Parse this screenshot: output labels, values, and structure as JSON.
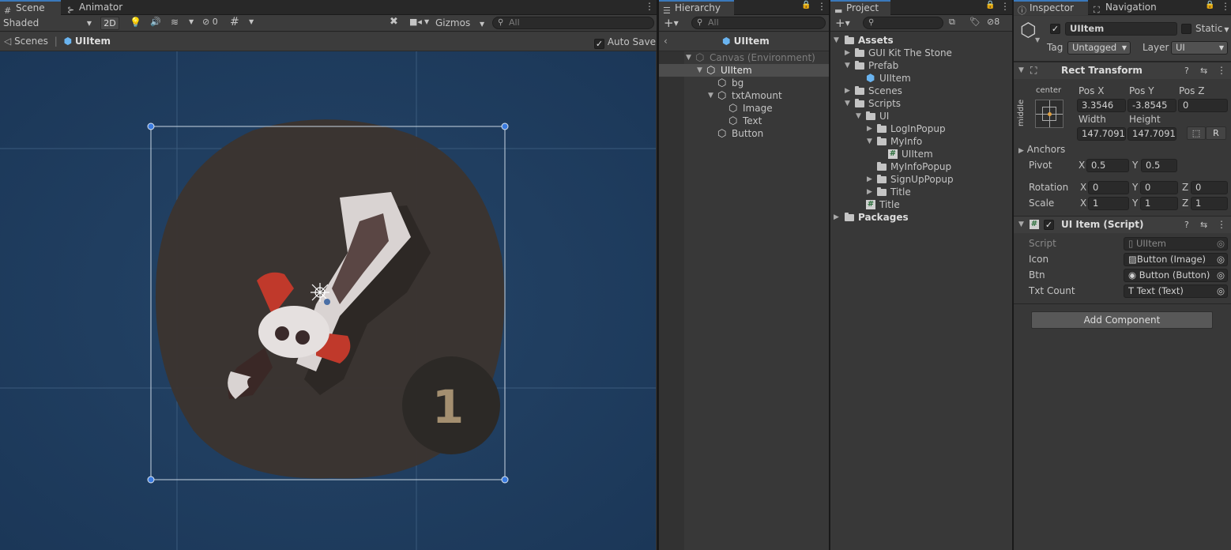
{
  "scene": {
    "tabs": [
      "Scene",
      "Animator"
    ],
    "shading_mode": "Shaded",
    "toggle_2d": "2D",
    "hidden_count": "0",
    "gizmos_label": "Gizmos",
    "search_placeholder": "All",
    "breadcrumb_root": "Scenes",
    "breadcrumb_item": "UIItem",
    "auto_save_label": "Auto Save",
    "item_count": "1"
  },
  "hierarchy": {
    "tab": "Hierarchy",
    "search_placeholder": "All",
    "prefab_title": "UIItem",
    "items": [
      {
        "label": "Canvas (Environment)",
        "indent": 0,
        "expanded": true,
        "dim": true
      },
      {
        "label": "UIItem",
        "indent": 1,
        "expanded": true,
        "selected": true
      },
      {
        "label": "bg",
        "indent": 2
      },
      {
        "label": "txtAmount",
        "indent": 2,
        "expanded": true
      },
      {
        "label": "Image",
        "indent": 3
      },
      {
        "label": "Text",
        "indent": 3
      },
      {
        "label": "Button",
        "indent": 2
      }
    ]
  },
  "project": {
    "tab": "Project",
    "hidden_count": "8",
    "items": [
      {
        "label": "Assets",
        "indent": 0,
        "type": "folder",
        "arrow": "down",
        "bold": true
      },
      {
        "label": "GUI Kit The Stone",
        "indent": 1,
        "type": "folder",
        "arrow": "right"
      },
      {
        "label": "Prefab",
        "indent": 1,
        "type": "folder",
        "arrow": "down"
      },
      {
        "label": "UIItem",
        "indent": 2,
        "type": "prefab"
      },
      {
        "label": "Scenes",
        "indent": 1,
        "type": "folder",
        "arrow": "right"
      },
      {
        "label": "Scripts",
        "indent": 1,
        "type": "folder",
        "arrow": "down"
      },
      {
        "label": "UI",
        "indent": 2,
        "type": "folder",
        "arrow": "down"
      },
      {
        "label": "LogInPopup",
        "indent": 3,
        "type": "folder",
        "arrow": "right"
      },
      {
        "label": "MyInfo",
        "indent": 3,
        "type": "folder",
        "arrow": "down"
      },
      {
        "label": "UIItem",
        "indent": 4,
        "type": "script"
      },
      {
        "label": "MyInfoPopup",
        "indent": 3,
        "type": "folder"
      },
      {
        "label": "SignUpPopup",
        "indent": 3,
        "type": "folder",
        "arrow": "right"
      },
      {
        "label": "Title",
        "indent": 3,
        "type": "folder",
        "arrow": "right"
      },
      {
        "label": "Title",
        "indent": 2,
        "type": "script"
      },
      {
        "label": "Packages",
        "indent": 0,
        "type": "folder",
        "arrow": "right",
        "bold": true
      }
    ]
  },
  "inspector": {
    "tabs": [
      "Inspector",
      "Navigation"
    ],
    "object_name": "UIItem",
    "static_label": "Static",
    "tag_label": "Tag",
    "tag_value": "Untagged",
    "layer_label": "Layer",
    "layer_value": "UI",
    "rect_transform": {
      "title": "Rect Transform",
      "anchor_h": "center",
      "anchor_v": "middle",
      "pos_x_label": "Pos X",
      "pos_y_label": "Pos Y",
      "pos_z_label": "Pos Z",
      "pos_x": "3.3546",
      "pos_y": "-3.8545",
      "pos_z": "0",
      "width_label": "Width",
      "height_label": "Height",
      "width": "147.7091",
      "height": "147.7091",
      "r_label": "R",
      "anchors_label": "Anchors",
      "pivot_label": "Pivot",
      "pivot_x": "0.5",
      "pivot_y": "0.5",
      "rotation_label": "Rotation",
      "rot_x": "0",
      "rot_y": "0",
      "rot_z": "0",
      "scale_label": "Scale",
      "scale_x": "1",
      "scale_y": "1",
      "scale_z": "1",
      "x": "X",
      "y": "Y",
      "z": "Z"
    },
    "script_comp": {
      "title": "UI Item (Script)",
      "fields": [
        {
          "label": "Script",
          "value": "UIItem",
          "dim": true
        },
        {
          "label": "Icon",
          "value": "Button (Image)"
        },
        {
          "label": "Btn",
          "value": "Button (Button)"
        },
        {
          "label": "Txt Count",
          "value": "Text (Text)"
        }
      ]
    },
    "add_component": "Add Component"
  }
}
